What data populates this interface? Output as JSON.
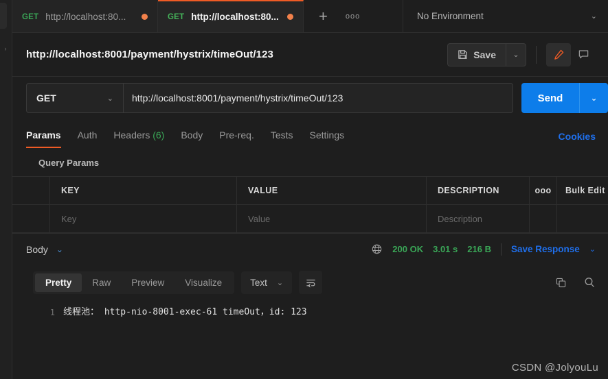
{
  "tabs": [
    {
      "method": "GET",
      "title": "http://localhost:80...",
      "unsaved": true,
      "active": false
    },
    {
      "method": "GET",
      "title": "http://localhost:80...",
      "unsaved": true,
      "active": true
    }
  ],
  "tab_actions": {
    "new_tab": "+",
    "more": "ooo"
  },
  "environment": {
    "selected": "No Environment",
    "caret": "⌄"
  },
  "request": {
    "title": "http://localhost:8001/payment/hystrix/timeOut/123",
    "save_label": "Save",
    "save_caret": "⌄",
    "method": "GET",
    "method_caret": "⌄",
    "url": "http://localhost:8001/payment/hystrix/timeOut/123",
    "send_label": "Send",
    "send_caret": "⌄"
  },
  "request_tabs": [
    {
      "label": "Params",
      "count": "",
      "active": true
    },
    {
      "label": "Auth",
      "count": "",
      "active": false
    },
    {
      "label": "Headers",
      "count": "(6)",
      "active": false
    },
    {
      "label": "Body",
      "count": "",
      "active": false
    },
    {
      "label": "Pre-req.",
      "count": "",
      "active": false
    },
    {
      "label": "Tests",
      "count": "",
      "active": false
    },
    {
      "label": "Settings",
      "count": "",
      "active": false
    }
  ],
  "cookies_label": "Cookies",
  "query_params": {
    "section_label": "Query Params",
    "headers": {
      "key": "KEY",
      "value": "VALUE",
      "description": "DESCRIPTION",
      "more": "ooo",
      "bulk_edit": "Bulk Edit"
    },
    "rows": [
      {
        "key": "Key",
        "value": "Value",
        "description": "Description"
      }
    ]
  },
  "response": {
    "body_label": "Body",
    "body_caret": "⌄",
    "status": "200 OK",
    "time": "3.01 s",
    "size": "216 B",
    "save_response": "Save Response",
    "save_response_caret": "⌄",
    "view_tabs": [
      {
        "label": "Pretty",
        "active": true
      },
      {
        "label": "Raw",
        "active": false
      },
      {
        "label": "Preview",
        "active": false
      },
      {
        "label": "Visualize",
        "active": false
      }
    ],
    "format": "Text",
    "format_caret": "⌄",
    "lines": [
      {
        "num": "1",
        "text": "线程池： http-nio-8001-exec-61 timeOut，id: 123"
      }
    ]
  },
  "watermark": "CSDN @JolyouLu",
  "colors": {
    "accent_orange": "#ef5b25",
    "send_blue": "#0d7dea",
    "link_blue": "#1f6feb",
    "status_green": "#3aa757",
    "unsaved_dot": "#f2814b",
    "app_bg": "#1e1e1e"
  }
}
